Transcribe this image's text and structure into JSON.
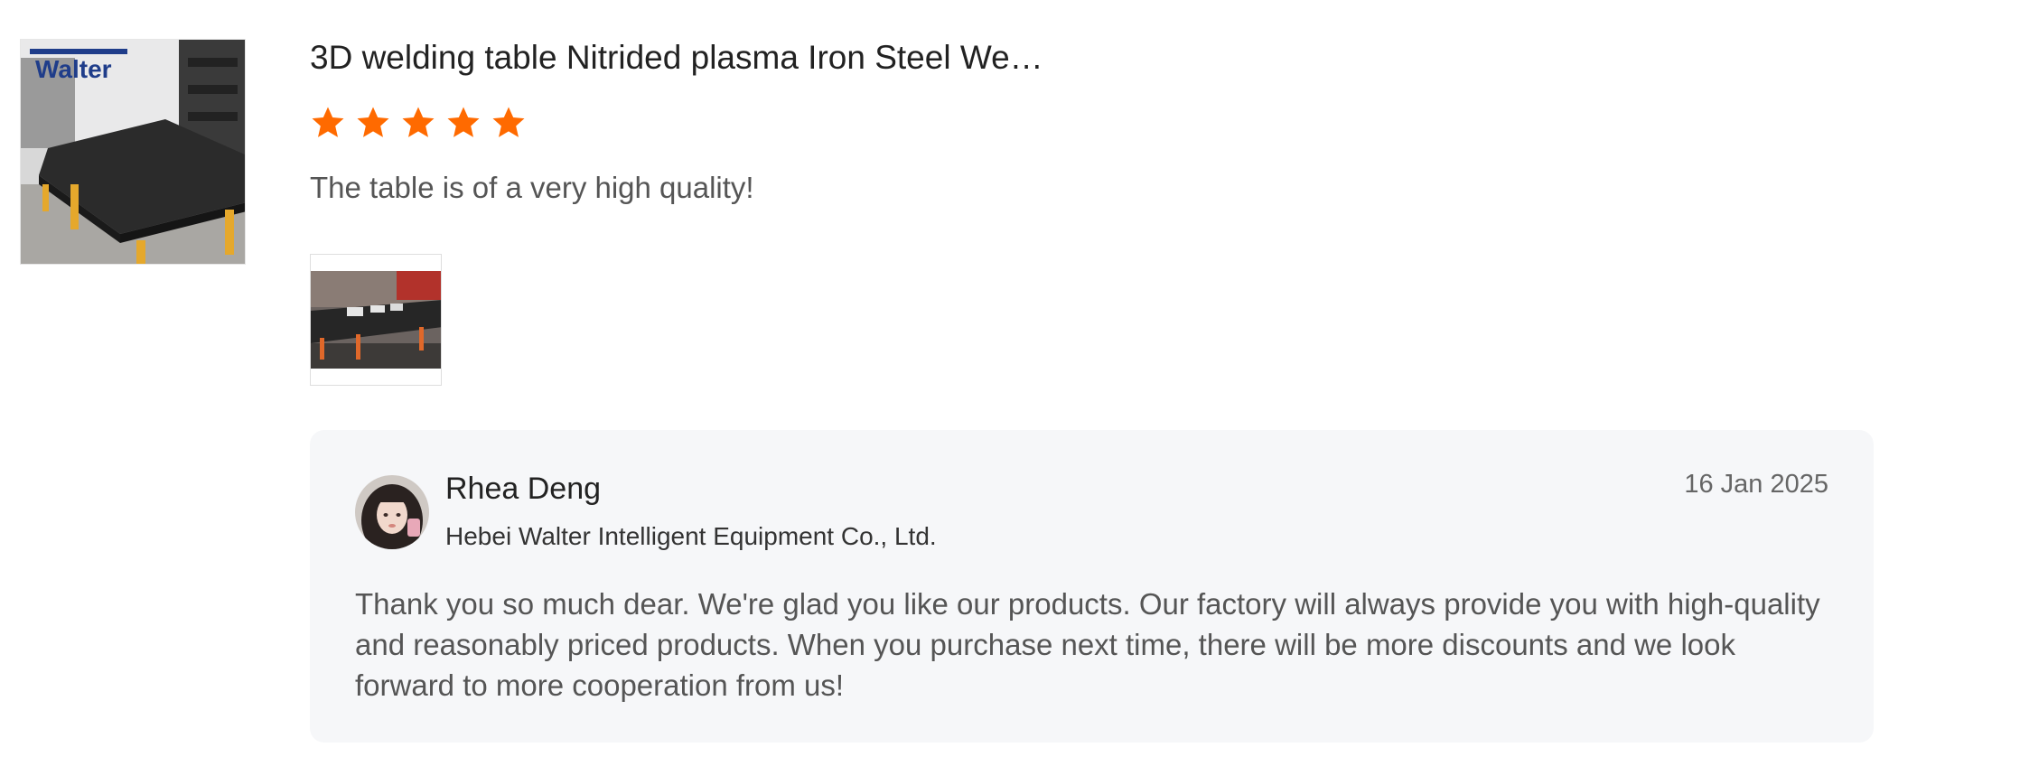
{
  "product": {
    "title": "3D welding table Nitrided plasma Iron Steel We…",
    "thumbnail_logo": "Walter",
    "thumbnail_icon": "product-image"
  },
  "review": {
    "rating": 5,
    "max_rating": 5,
    "star_color": "#ff6a00",
    "text": "The table is of a very high quality!",
    "photo_icon": "review-photo"
  },
  "reply": {
    "name": "Rhea Deng",
    "company": "Hebei Walter Intelligent Equipment Co., Ltd.",
    "date": "16 Jan 2025",
    "text": "Thank you so much dear. We're glad you like our products. Our factory will always provide you with high-quality and reasonably priced products. When you purchase next time, there will be more discounts and we look forward to more cooperation from us!"
  }
}
